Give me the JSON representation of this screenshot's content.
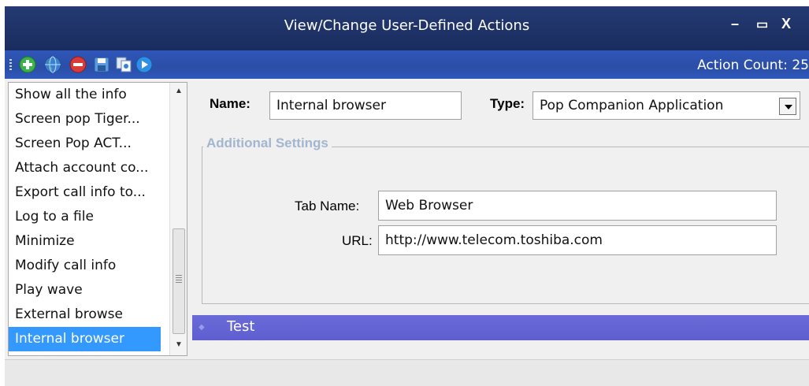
{
  "window": {
    "title": "View/Change User-Defined Actions",
    "minimize_glyph": "–",
    "maximize_glyph": "▭",
    "close_glyph": "X"
  },
  "toolbar": {
    "buttons": [
      {
        "icon": "add-icon",
        "color": "#3cb34a"
      },
      {
        "icon": "globe-icon",
        "color": "#3a7fd0"
      },
      {
        "icon": "remove-icon",
        "color": "#d93a3a"
      },
      {
        "icon": "save-icon",
        "color": "#5b9be0"
      },
      {
        "icon": "copy-icon",
        "color": "#8aa4c8"
      },
      {
        "icon": "play-icon",
        "color": "#2f8fe6"
      }
    ],
    "action_count": "Action Count: 25"
  },
  "actions_list": {
    "items": [
      "Show all the info",
      "Screen pop Tiger...",
      "Screen Pop ACT...",
      "Attach account co...",
      "Export call info to...",
      "Log to a file",
      "Minimize",
      "Modify call info",
      "Play wave",
      "External browse",
      "Internal browser"
    ],
    "selected_index": 10
  },
  "form": {
    "name_label": "Name:",
    "name_value": "Internal browser",
    "type_label": "Type:",
    "type_value": "Pop Companion Application",
    "group_title": "Additional Settings",
    "tab_name_label": "Tab Name:",
    "tab_name_value": "Web Browser",
    "url_label": "URL:",
    "url_value": "http://www.telecom.toshiba.com"
  },
  "test_bar": {
    "label": "Test"
  }
}
